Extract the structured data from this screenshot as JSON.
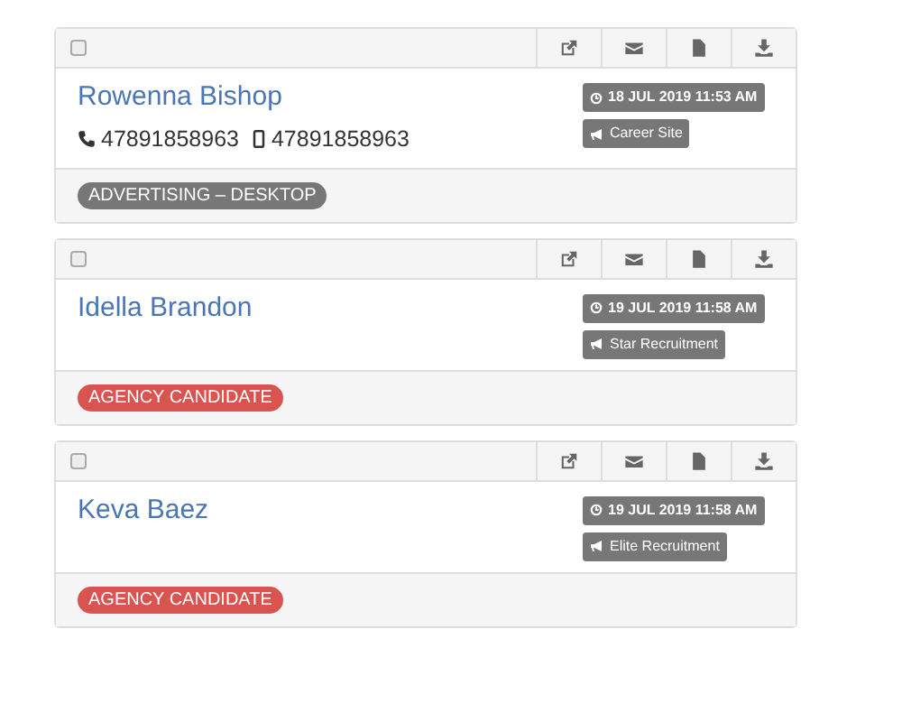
{
  "candidates": [
    {
      "checked": false,
      "name": "Rowenna Bishop",
      "phones": [
        {
          "kind": "phone",
          "number": "47891858963"
        },
        {
          "kind": "mobile",
          "number": "47891858963"
        }
      ],
      "date": "18 JUL 2019 11:53 AM",
      "source": "Career Site",
      "tag": {
        "label": "ADVERTISING – DESKTOP",
        "color": "#777777"
      }
    },
    {
      "checked": false,
      "name": "Idella Brandon",
      "date": "19 JUL 2019 11:58 AM",
      "source": "Star Recruitment",
      "tag": {
        "label": "AGENCY CANDIDATE",
        "color": "#d9534f"
      }
    },
    {
      "checked": false,
      "name": "Keva Baez",
      "date": "19 JUL 2019 11:58 AM",
      "source": "Elite Recruitment",
      "tag": {
        "label": "AGENCY CANDIDATE",
        "color": "#d9534f"
      }
    }
  ]
}
